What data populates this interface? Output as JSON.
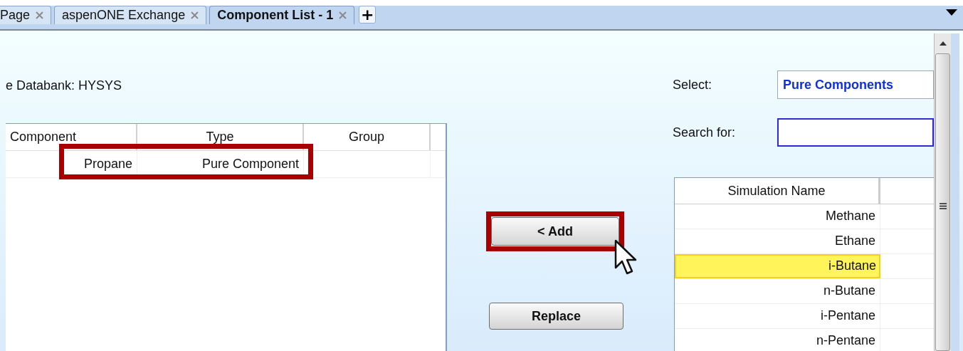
{
  "tabs": [
    {
      "label": "Page",
      "selected": false
    },
    {
      "label": "aspenONE Exchange",
      "selected": false
    },
    {
      "label": "Component List - 1",
      "selected": true
    }
  ],
  "new_tab_button": {
    "label": "+"
  },
  "databank_label": "e Databank: HYSYS",
  "component_table": {
    "columns": [
      "Component",
      "Type",
      "Group"
    ],
    "rows": [
      {
        "component": "Propane",
        "type": "Pure Component",
        "annotated": true
      }
    ]
  },
  "buttons": [
    {
      "label": "< Add",
      "annotated": true
    },
    {
      "label": "Replace",
      "annotated": false
    }
  ],
  "select": {
    "label": "Select:",
    "value": "Pure Components"
  },
  "search": {
    "label": "Search for:"
  },
  "simulation_table": {
    "columns": [
      "Simulation Name"
    ],
    "rows": [
      {
        "name": "Methane",
        "selected": false
      },
      {
        "name": "Ethane",
        "selected": false
      },
      {
        "name": "i-Butane",
        "selected": true
      },
      {
        "name": "n-Butane",
        "selected": false
      },
      {
        "name": "i-Pentane",
        "selected": false
      },
      {
        "name": "n-Pentane",
        "selected": false
      }
    ]
  }
}
